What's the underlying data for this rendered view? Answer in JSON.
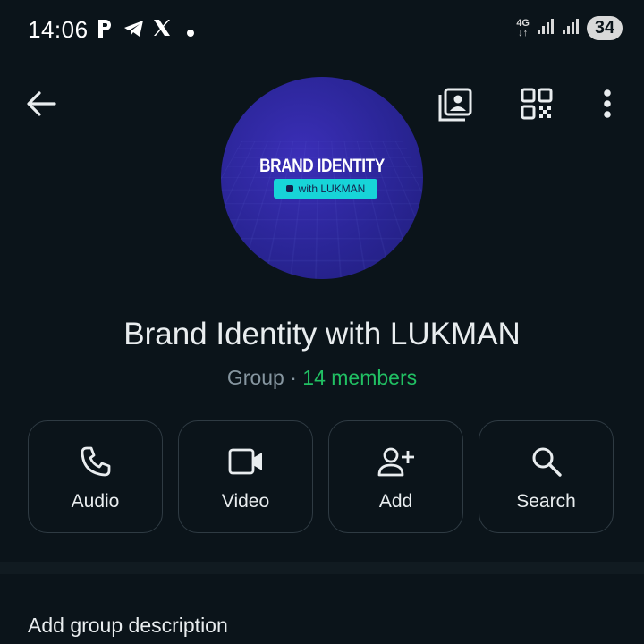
{
  "status_bar": {
    "time": "14:06",
    "network": "4G",
    "battery": "34",
    "notification_icons": [
      "p-app-icon",
      "telegram-icon",
      "x-icon",
      "dot-icon"
    ]
  },
  "header": {
    "actions": [
      "back-arrow-icon",
      "gallery-icon",
      "qr-code-icon",
      "more-vert-icon"
    ]
  },
  "avatar": {
    "title": "BRAND IDENTITY",
    "subtitle": "with LUKMAN"
  },
  "group": {
    "name": "Brand Identity with LUKMAN",
    "type": "Group",
    "separator": " · ",
    "members": "14 members"
  },
  "actions": [
    {
      "label": "Audio",
      "icon": "phone-icon"
    },
    {
      "label": "Video",
      "icon": "video-icon"
    },
    {
      "label": "Add",
      "icon": "add-person-icon"
    },
    {
      "label": "Search",
      "icon": "search-icon"
    }
  ],
  "description": {
    "placeholder": "Add group description"
  },
  "colors": {
    "background": "#0b141a",
    "accent": "#21c063",
    "muted": "#8696a0",
    "border": "#2f3b43"
  }
}
